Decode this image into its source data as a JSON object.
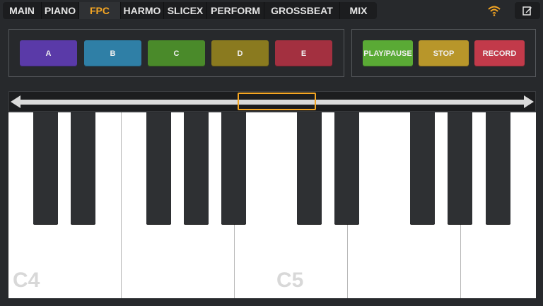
{
  "nav": {
    "tabs": [
      {
        "label": "MAIN",
        "active": false
      },
      {
        "label": "PIANO",
        "active": false
      },
      {
        "label": "FPC",
        "active": true
      },
      {
        "label": "HARMO",
        "active": false
      },
      {
        "label": "SLICEX",
        "active": false
      },
      {
        "label": "PERFORM",
        "active": false
      },
      {
        "label": "GROSSBEAT",
        "active": false
      },
      {
        "label": "MIX",
        "active": false
      }
    ],
    "wifi_icon": "wifi-icon",
    "edit_icon": "edit-icon"
  },
  "pads": [
    {
      "label": "A",
      "color": "#5a3aa8"
    },
    {
      "label": "B",
      "color": "#2f7fa6"
    },
    {
      "label": "C",
      "color": "#4a8a2a"
    },
    {
      "label": "D",
      "color": "#8a7a1f"
    },
    {
      "label": "E",
      "color": "#a33040"
    }
  ],
  "transport": [
    {
      "label": "PLAY/PAUSE",
      "color": "#5aaa35"
    },
    {
      "label": "STOP",
      "color": "#b8962a"
    },
    {
      "label": "RECORD",
      "color": "#c23a4a"
    }
  ],
  "keyboard": {
    "octave_labels": [
      "C4",
      "C5"
    ]
  },
  "colors": {
    "accent": "#f5a623",
    "background": "#27292c"
  }
}
